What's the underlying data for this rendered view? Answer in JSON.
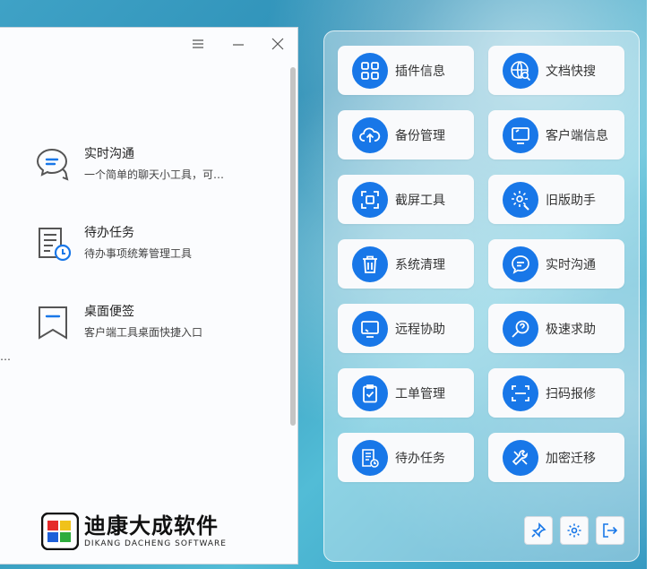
{
  "left_window": {
    "controls": {
      "menu": "≡",
      "minimize": "—",
      "close": "✕"
    },
    "entries": [
      {
        "title": "实时沟通",
        "desc": "一个简单的聊天小工具，可…",
        "icon": "chat-icon"
      },
      {
        "title": "待办任务",
        "desc": "待办事项统筹管理工具",
        "icon": "todo-list-icon"
      },
      {
        "title": "桌面便签",
        "desc": "客户端工具桌面快捷入口",
        "icon": "bookmark-icon"
      }
    ],
    "left_ellipsis": "…",
    "logo": {
      "cn": "迪康大成软件",
      "en": "DIKANG DACHENG SOFTWARE"
    }
  },
  "panel": {
    "tiles": [
      {
        "label": "插件信息",
        "icon": "grid-icon"
      },
      {
        "label": "文档快搜",
        "icon": "globe-search-icon"
      },
      {
        "label": "备份管理",
        "icon": "cloud-upload-icon"
      },
      {
        "label": "客户端信息",
        "icon": "monitor-icon"
      },
      {
        "label": "截屏工具",
        "icon": "screenshot-icon"
      },
      {
        "label": "旧版助手",
        "icon": "gear-wrench-icon"
      },
      {
        "label": "系统清理",
        "icon": "trash-icon"
      },
      {
        "label": "实时沟通",
        "icon": "chat-icon"
      },
      {
        "label": "远程协助",
        "icon": "remote-desktop-icon"
      },
      {
        "label": "极速求助",
        "icon": "search-help-icon"
      },
      {
        "label": "工单管理",
        "icon": "clipboard-check-icon"
      },
      {
        "label": "扫码报修",
        "icon": "scan-icon"
      },
      {
        "label": "待办任务",
        "icon": "todo-list-icon"
      },
      {
        "label": "加密迁移",
        "icon": "tools-icon"
      }
    ],
    "bottom_buttons": [
      "pin-icon",
      "settings-icon",
      "logout-icon"
    ]
  },
  "colors": {
    "accent": "#1877e8",
    "panel_bg": "rgba(255,255,255,0.35)"
  }
}
